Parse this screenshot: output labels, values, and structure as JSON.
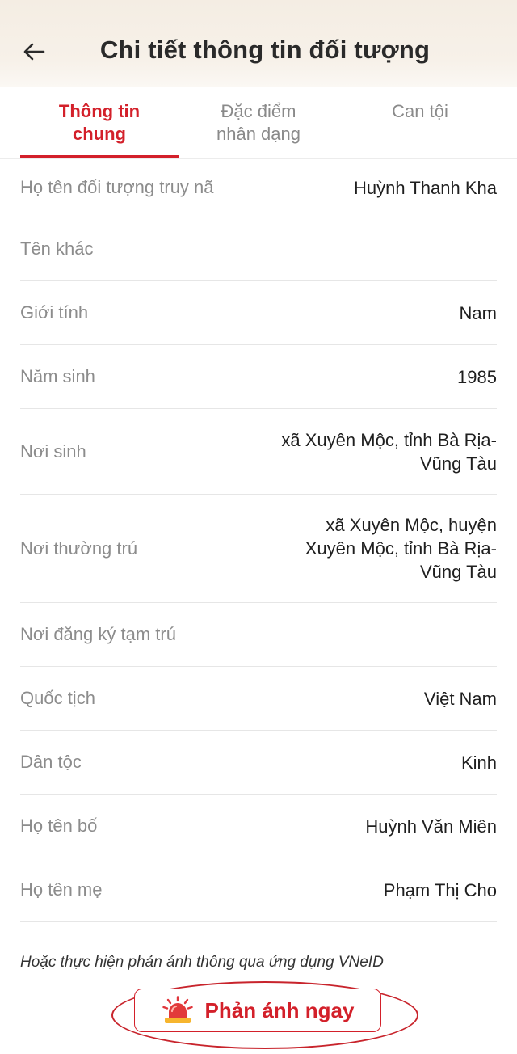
{
  "header": {
    "title": "Chi tiết thông tin đối tượng"
  },
  "tabs": [
    {
      "line1": "Thông tin",
      "line2": "chung",
      "active": true
    },
    {
      "line1": "Đặc điểm",
      "line2": "nhân dạng",
      "active": false
    },
    {
      "line1": "Can tội",
      "line2": "",
      "active": false
    }
  ],
  "details": {
    "full_name": {
      "label": "Họ tên đối tượng truy nã",
      "value": "Huỳnh Thanh Kha"
    },
    "alias": {
      "label": "Tên khác",
      "value": ""
    },
    "gender": {
      "label": "Giới tính",
      "value": "Nam"
    },
    "birth_year": {
      "label": "Năm sinh",
      "value": "1985"
    },
    "birthplace": {
      "label": "Nơi sinh",
      "value_lines": [
        "xã Xuyên Mộc, tỉnh Bà Rịa-",
        "Vũng Tàu"
      ]
    },
    "permanent_residence": {
      "label": "Nơi thường trú",
      "value_lines": [
        "xã Xuyên Mộc, huyện",
        "Xuyên Mộc, tỉnh Bà Rịa-",
        "Vũng Tàu"
      ]
    },
    "temporary_residence": {
      "label": "Nơi đăng ký tạm trú",
      "value": ""
    },
    "nationality": {
      "label": "Quốc tịch",
      "value": "Việt Nam"
    },
    "ethnicity": {
      "label": "Dân tộc",
      "value": "Kinh"
    },
    "father_name": {
      "label": "Họ tên bố",
      "value": "Huỳnh Văn Miên"
    },
    "mother_name": {
      "label": "Họ tên mẹ",
      "value": "Phạm Thị Cho"
    }
  },
  "footer": {
    "note": "Hoặc thực hiện phản ánh thông qua ứng dụng VNeID",
    "report_button_label": "Phản ánh ngay",
    "report_icon": "siren-icon"
  },
  "colors": {
    "accent": "#d3202a",
    "header_bg": "#f4ede3"
  }
}
